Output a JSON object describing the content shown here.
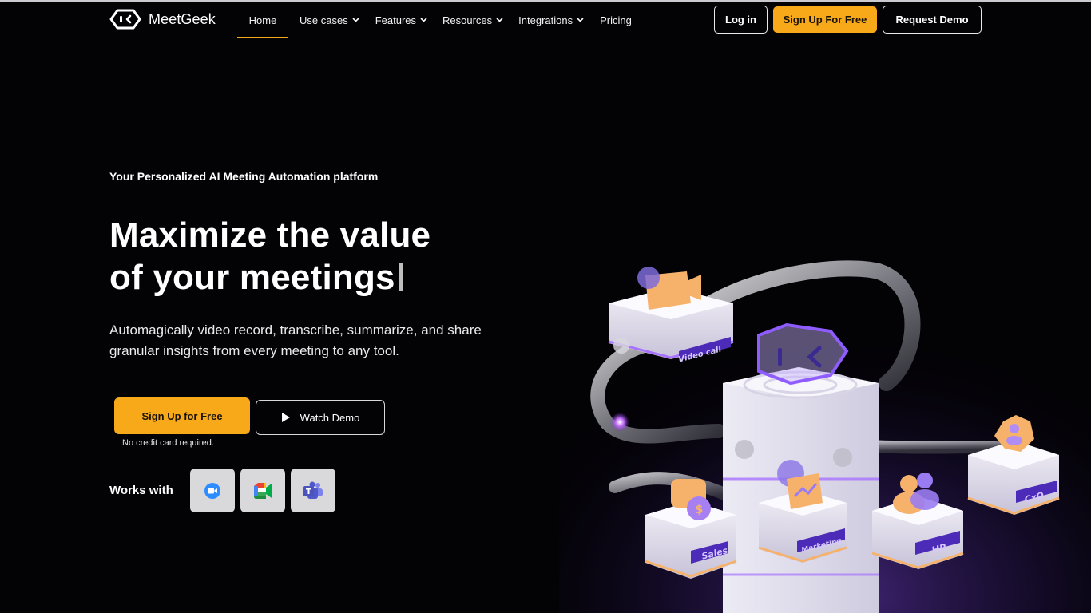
{
  "brand": {
    "name": "MeetGeek",
    "accent": "#f7a919"
  },
  "nav": {
    "items": [
      {
        "label": "Home",
        "active": true
      },
      {
        "label": "Use cases",
        "dropdown": true
      },
      {
        "label": "Features",
        "dropdown": true
      },
      {
        "label": "Resources",
        "dropdown": true
      },
      {
        "label": "Integrations",
        "dropdown": true
      },
      {
        "label": "Pricing"
      }
    ],
    "login_label": "Log in",
    "signup_label": "Sign Up For Free",
    "demo_label": "Request Demo"
  },
  "hero": {
    "eyebrow": "Your Personalized AI Meeting Automation platform",
    "headline_line1": "Maximize the value",
    "headline_line2": "of your meetings",
    "subtext": "Automagically video record, transcribe, summarize, and share granular insights from every meeting to any tool.",
    "signup_label": "Sign Up for Free",
    "watch_label": "Watch Demo",
    "note": "No credit card required.",
    "works_with_label": "Works with",
    "apps": [
      {
        "icon": "zoom-icon"
      },
      {
        "icon": "google-meet-icon"
      },
      {
        "icon": "microsoft-teams-icon"
      }
    ]
  },
  "illustration": {
    "tags": {
      "video_call": "Video call",
      "sales": "Sales",
      "marketing": "Marketing",
      "hr": "HR",
      "cxo": "CxO"
    }
  }
}
